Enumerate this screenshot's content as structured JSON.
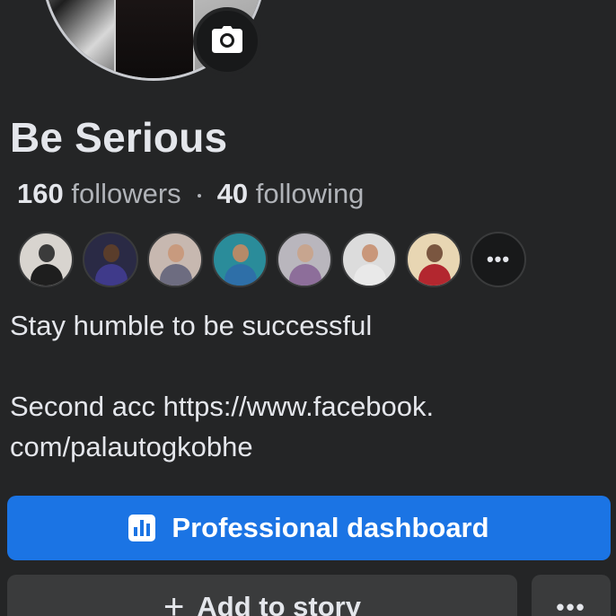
{
  "profile": {
    "name": "Be Serious",
    "followers_count": "160",
    "followers_label": "followers",
    "following_count": "40",
    "following_label": "following"
  },
  "friends_preview": {
    "more_label": "•••",
    "items": [
      {
        "head": "#3b3b3b",
        "body": "#1e1e1e",
        "bg": "#d8d4cf"
      },
      {
        "head": "#5a3d2b",
        "body": "#3f3a8a",
        "bg": "#2a2a45"
      },
      {
        "head": "#c89a7e",
        "body": "#6d6c80",
        "bg": "#c7b8b0"
      },
      {
        "head": "#b58a68",
        "body": "#2e6fa8",
        "bg": "#2a8c9a"
      },
      {
        "head": "#c7a58f",
        "body": "#8d6e9a",
        "bg": "#b9b6bd"
      },
      {
        "head": "#c9977a",
        "body": "#e9e9e9",
        "bg": "#dcdcdc"
      },
      {
        "head": "#7a5640",
        "body": "#b3272f",
        "bg": "#e8d6b3"
      }
    ]
  },
  "bio": {
    "line1": "Stay humble to be successful",
    "line2": "Second acc https://www.facebook.",
    "line3": "com/palautogkobhe"
  },
  "actions": {
    "professional_dashboard": "Professional dashboard",
    "add_to_story": "Add to story",
    "more": "•••"
  },
  "colors": {
    "background": "#242526",
    "primary": "#1b74e4",
    "secondary_button": "#3a3b3c",
    "text": "#e4e6eb",
    "muted_text": "#b0b3b8"
  },
  "icons": {
    "camera": "camera-icon",
    "dashboard": "bar-chart-icon",
    "plus": "plus-icon",
    "more": "ellipsis-icon"
  }
}
